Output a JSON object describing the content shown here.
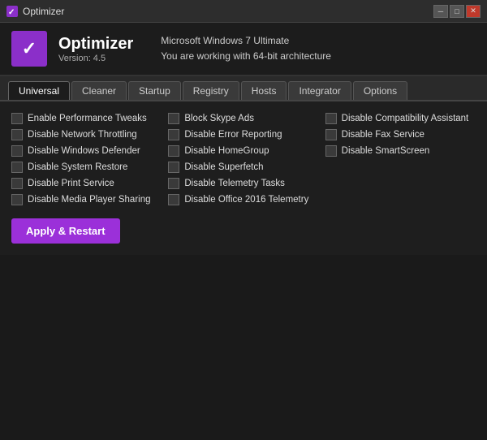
{
  "titlebar": {
    "icon": "✓",
    "title": "Optimizer",
    "controls": {
      "minimize": "─",
      "maximize": "□",
      "close": "✕"
    }
  },
  "header": {
    "logo_check": "✓",
    "app_name": "Optimizer",
    "app_version": "Version: 4.5",
    "info_line1": "Microsoft Windows 7 Ultimate",
    "info_line2": "You are working with 64-bit architecture"
  },
  "tabs": [
    {
      "label": "Universal",
      "active": true
    },
    {
      "label": "Cleaner",
      "active": false
    },
    {
      "label": "Startup",
      "active": false
    },
    {
      "label": "Registry",
      "active": false
    },
    {
      "label": "Hosts",
      "active": false
    },
    {
      "label": "Integrator",
      "active": false
    },
    {
      "label": "Options",
      "active": false
    }
  ],
  "options": {
    "col1": [
      "Enable Performance Tweaks",
      "Disable Network Throttling",
      "Disable Windows Defender",
      "Disable System Restore",
      "Disable Print Service",
      "Disable Media Player Sharing"
    ],
    "col2": [
      "Block Skype Ads",
      "Disable Error Reporting",
      "Disable HomeGroup",
      "Disable Superfetch",
      "Disable Telemetry Tasks",
      "Disable Office 2016 Telemetry"
    ],
    "col3": [
      "Disable Compatibility Assistant",
      "Disable Fax Service",
      "Disable SmartScreen",
      "",
      "",
      ""
    ]
  },
  "apply_button": "Apply & Restart",
  "colors": {
    "accent": "#9b30d9",
    "bg": "#1e1e1e",
    "title_bg": "#2d2d2d"
  }
}
